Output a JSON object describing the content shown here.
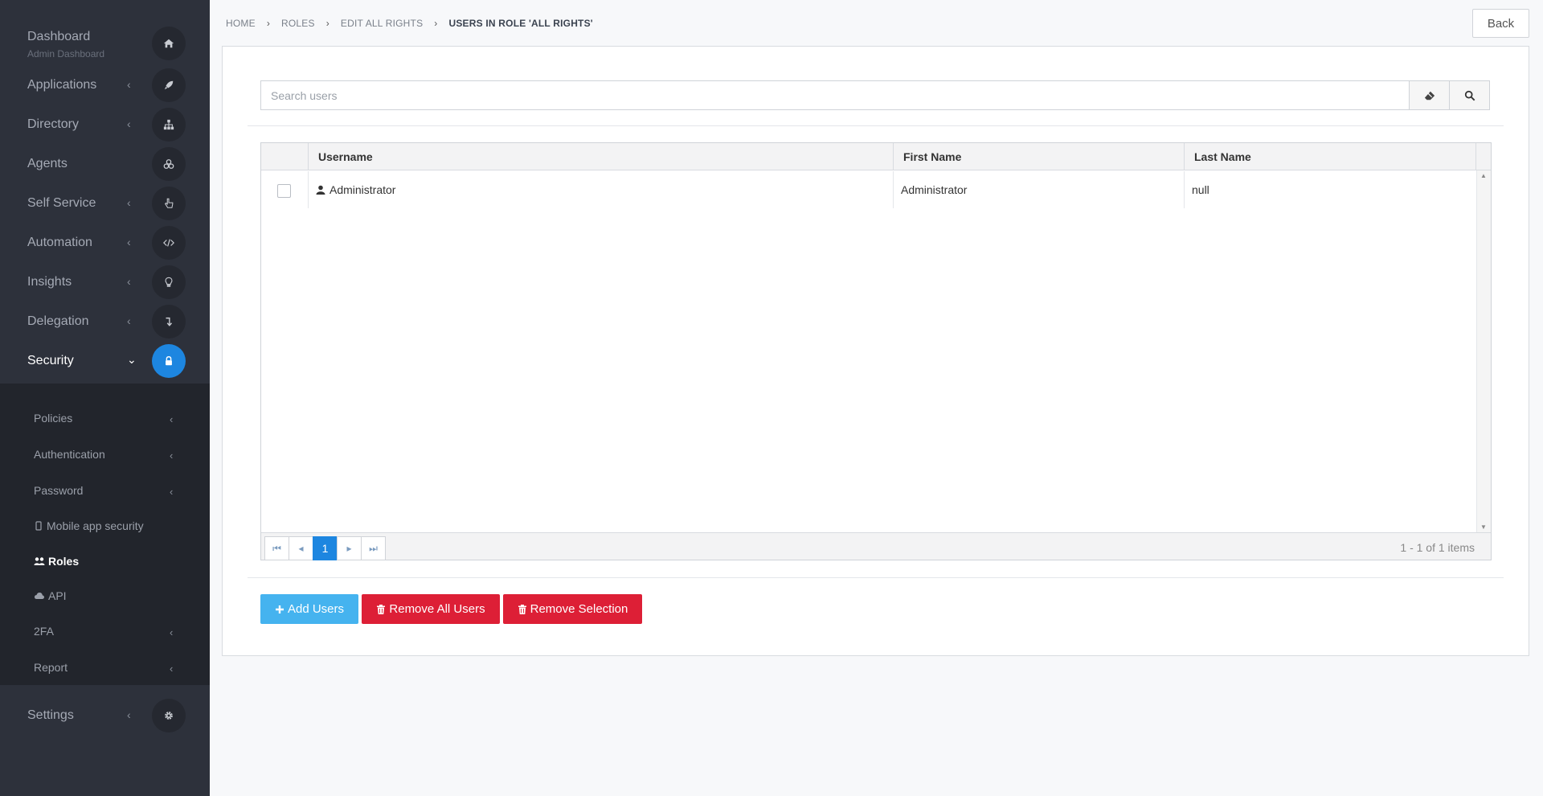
{
  "sidebar": {
    "items": [
      {
        "label": "Dashboard",
        "sublabel": "Admin Dashboard",
        "icon": "home-icon"
      },
      {
        "label": "Applications",
        "icon": "rocket-icon"
      },
      {
        "label": "Directory",
        "icon": "sitemap-icon"
      },
      {
        "label": "Agents",
        "icon": "cubes-icon"
      },
      {
        "label": "Self Service",
        "icon": "hand-pointer-icon"
      },
      {
        "label": "Automation",
        "icon": "code-icon"
      },
      {
        "label": "Insights",
        "icon": "lightbulb-icon"
      },
      {
        "label": "Delegation",
        "icon": "level-down-icon"
      },
      {
        "label": "Security",
        "icon": "lock-icon"
      },
      {
        "label": "Settings",
        "icon": "gear-icon"
      }
    ],
    "security_sub": [
      {
        "label": "Policies"
      },
      {
        "label": "Authentication"
      },
      {
        "label": "Password"
      },
      {
        "label": "Mobile app security",
        "icon": "mobile-icon"
      },
      {
        "label": "Roles",
        "icon": "users-icon"
      },
      {
        "label": "API",
        "icon": "cloud-icon"
      },
      {
        "label": "2FA"
      },
      {
        "label": "Report"
      }
    ]
  },
  "breadcrumb": {
    "items": [
      "HOME",
      "ROLES",
      "EDIT ALL RIGHTS"
    ],
    "current": "USERS IN ROLE 'ALL RIGHTS'"
  },
  "back_label": "Back",
  "search": {
    "placeholder": "Search users"
  },
  "grid": {
    "columns": [
      "Username",
      "First Name",
      "Last Name"
    ],
    "rows": [
      {
        "username": "Administrator",
        "first_name": "Administrator",
        "last_name": "null"
      }
    ],
    "pager": {
      "current_page": "1",
      "info": "1 - 1 of 1 items"
    }
  },
  "actions": {
    "add_users": "Add Users",
    "remove_all": "Remove All Users",
    "remove_selection": "Remove Selection"
  },
  "colors": {
    "sidebar_bg": "#2d313b",
    "accent": "#1d86e0",
    "add_button": "#45b3ef",
    "danger_button": "#dd1f36"
  }
}
